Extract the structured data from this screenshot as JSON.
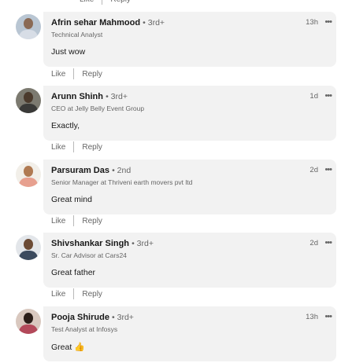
{
  "actions": {
    "like_label": "Like",
    "reply_label": "Reply"
  },
  "comments": [
    {
      "name": "Afrin sehar Mahmood",
      "degree": "• 3rd+",
      "headline": "Technical Analyst",
      "time": "13h",
      "text": "Just wow",
      "avatar": "person-avatar"
    },
    {
      "name": "Arunn Shinh",
      "degree": "• 3rd+",
      "headline": "CEO at Jelly Belly Event Group",
      "time": "1d",
      "text": "Exactly,",
      "avatar": "person-avatar"
    },
    {
      "name": "Parsuram Das",
      "degree": "• 2nd",
      "headline": "Senior Manager at Thriveni earth movers pvt ltd",
      "time": "2d",
      "text": "Great mind",
      "avatar": "person-avatar"
    },
    {
      "name": "Shivshankar Singh",
      "degree": "• 3rd+",
      "headline": "Sr. Car Advisor at Cars24",
      "time": "2d",
      "text": "Great father",
      "avatar": "person-avatar"
    },
    {
      "name": "Pooja Shirude",
      "degree": "• 3rd+",
      "headline": "Test Analyst at Infosys",
      "time": "13h",
      "text": "Great",
      "emoji": "👍",
      "avatar": "person-avatar"
    }
  ],
  "icons": {
    "more": "more-options-icon",
    "thumbs_up": "thumbs-up-emoji-icon"
  }
}
